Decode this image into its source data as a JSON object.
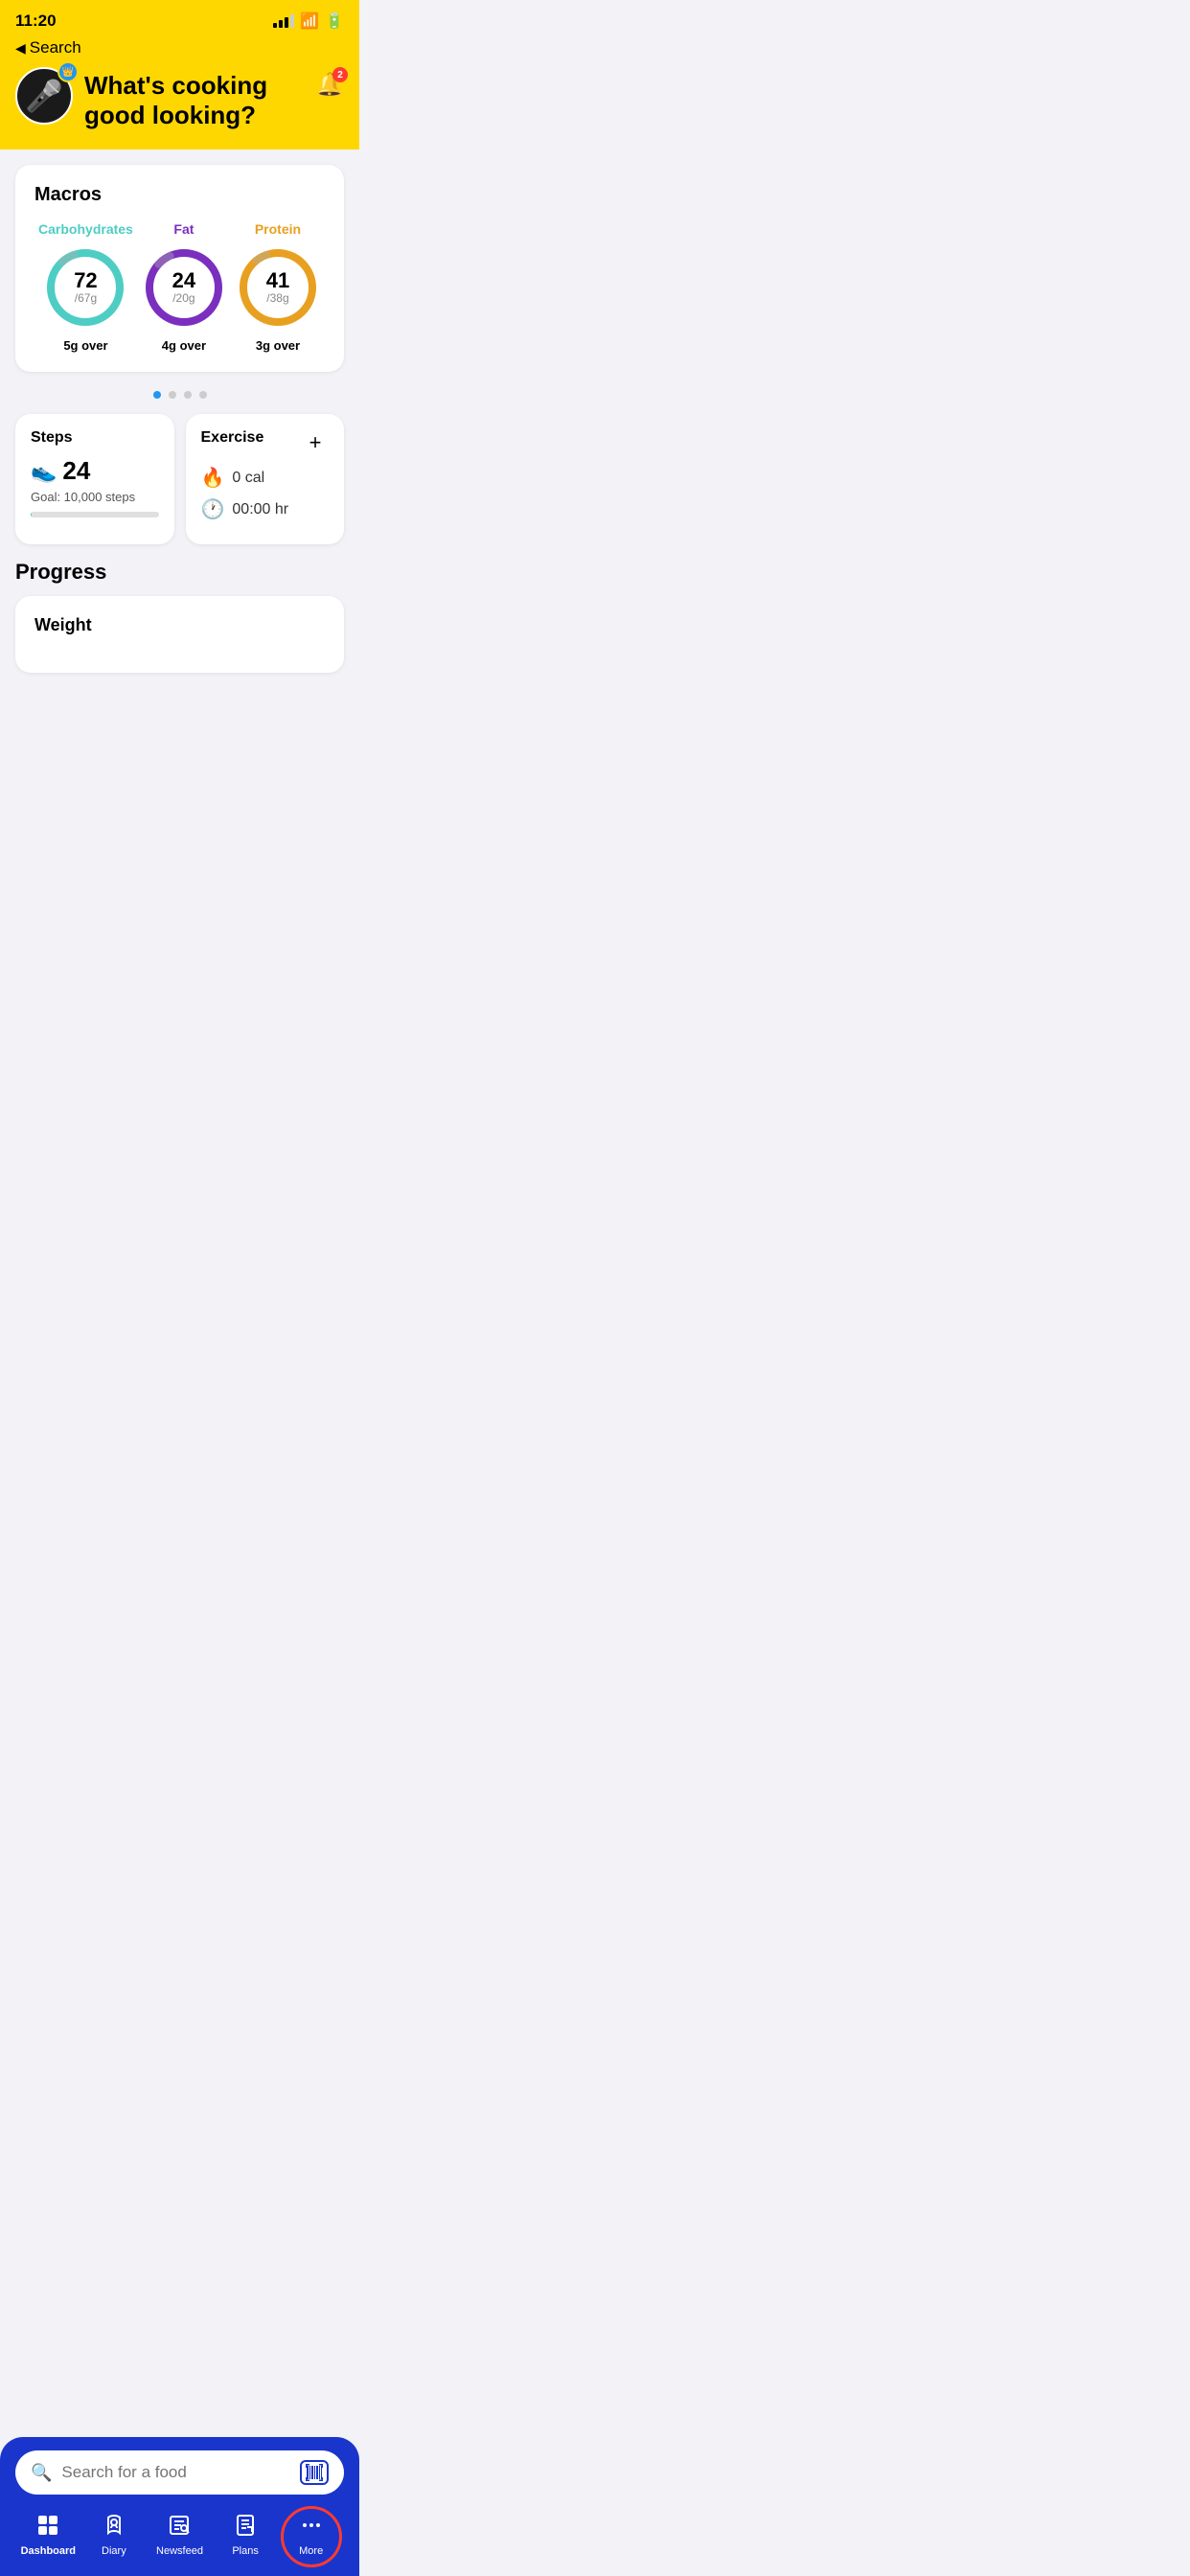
{
  "status": {
    "time": "11:20",
    "back_label": "Search"
  },
  "header": {
    "greeting": "What's cooking good looking?",
    "notification_count": "2"
  },
  "macros": {
    "title": "Macros",
    "carbs": {
      "label": "Carbohydrates",
      "value": "72",
      "goal": "/67g",
      "status": "5g over",
      "color": "#4ecdc4",
      "percent": 107,
      "bg_color": "#d0f5f2"
    },
    "fat": {
      "label": "Fat",
      "value": "24",
      "goal": "/20g",
      "status": "4g over",
      "color": "#7b2fbe",
      "percent": 120,
      "bg_color": "#ede0f7"
    },
    "protein": {
      "label": "Protein",
      "value": "41",
      "goal": "/38g",
      "status": "3g over",
      "color": "#e8a020",
      "percent": 108,
      "bg_color": "#fcefd0"
    }
  },
  "dots": [
    true,
    false,
    false,
    false
  ],
  "steps": {
    "title": "Steps",
    "value": "24",
    "goal_label": "Goal: 10,000 steps",
    "progress_percent": 0.24
  },
  "exercise": {
    "title": "Exercise",
    "calories": "0 cal",
    "duration": "00:00 hr"
  },
  "progress": {
    "title": "Progress",
    "weight_label": "Weight"
  },
  "search": {
    "placeholder": "Search for a food"
  },
  "tabs": [
    {
      "id": "dashboard",
      "label": "Dashboard",
      "active": true
    },
    {
      "id": "diary",
      "label": "Diary",
      "active": false
    },
    {
      "id": "newsfeed",
      "label": "Newsfeed",
      "active": false
    },
    {
      "id": "plans",
      "label": "Plans",
      "active": false
    },
    {
      "id": "more",
      "label": "More",
      "active": false,
      "highlighted": true
    }
  ]
}
